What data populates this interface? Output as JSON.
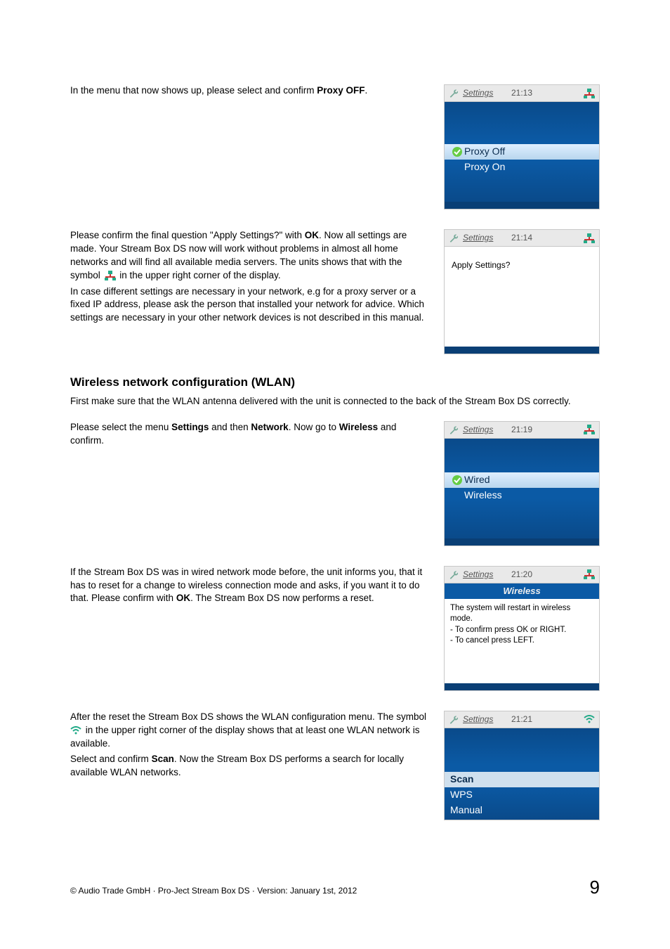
{
  "paragraphs": {
    "p1a": "In the menu that now shows up, please select and confirm ",
    "p1b": "Proxy OFF",
    "p1c": ".",
    "p2a": "Please confirm the final question \"Apply Settings?\" with ",
    "p2b": "OK",
    "p2c": ". Now all settings are made. Your Stream Box DS now will work without problems in almost all home networks and will find all available media servers. The units shows that with the symbol ",
    "p2d": " in the upper right corner of the display.",
    "p2e": "In case different settings are necessary in your network, e.g for a proxy server or a fixed IP address, please ask the person that installed your network for advice. Which settings are necessary in your other network devices is not described in this manual.",
    "h2": "Wireless network configuration (WLAN)",
    "p3": "First make sure that the WLAN antenna delivered with the unit is connected to the back of the Stream Box DS correctly.",
    "p4a": "Please select the menu ",
    "p4b": "Settings",
    "p4c": " and then ",
    "p4d": "Network",
    "p4e": ". Now go to ",
    "p4f": "Wireless",
    "p4g": " and confirm.",
    "p5a": "If the Stream Box DS was in wired network mode before, the unit informs you, that it has to reset for a change to wireless connection mode and asks, if you want it to do that. Please confirm with ",
    "p5b": "OK",
    "p5c": ". The Stream Box DS now performs a reset.",
    "p6a": "After the reset the Stream Box DS shows the WLAN configuration menu. The symbol ",
    "p6b": " in the upper right corner of the display shows that at least one WLAN network is available.",
    "p6c": "Select and confirm ",
    "p6d": "Scan",
    "p6e": ". Now the Stream Box DS performs a search for locally available WLAN networks."
  },
  "shots": {
    "s1": {
      "title": "Settings",
      "clock": "21:13",
      "net": "lan",
      "items": [
        {
          "label": "Proxy Off",
          "selected": true
        },
        {
          "label": "Proxy On",
          "selected": false
        }
      ]
    },
    "s2": {
      "title": "Settings",
      "clock": "21:14",
      "net": "lan",
      "message": "Apply Settings?"
    },
    "s3": {
      "title": "Settings",
      "clock": "21:19",
      "net": "lan",
      "items": [
        {
          "label": "Wired",
          "selected": true
        },
        {
          "label": "Wireless",
          "selected": false
        }
      ]
    },
    "s4": {
      "title": "Settings",
      "clock": "21:20",
      "net": "lan",
      "subtitle": "Wireless",
      "lines": [
        "The system will restart in wireless mode.",
        "- To confirm press OK or RIGHT.",
        "- To cancel press LEFT."
      ]
    },
    "s5": {
      "title": "Settings",
      "clock": "21:21",
      "net": "wifi",
      "items": [
        {
          "label": "Scan",
          "selected": true
        },
        {
          "label": "WPS",
          "selected": false
        },
        {
          "label": "Manual",
          "selected": false
        }
      ]
    }
  },
  "footer": {
    "copyright": "© Audio Trade GmbH · Pro-Ject Stream Box DS · Version: January 1st, 2012",
    "page": "9"
  }
}
